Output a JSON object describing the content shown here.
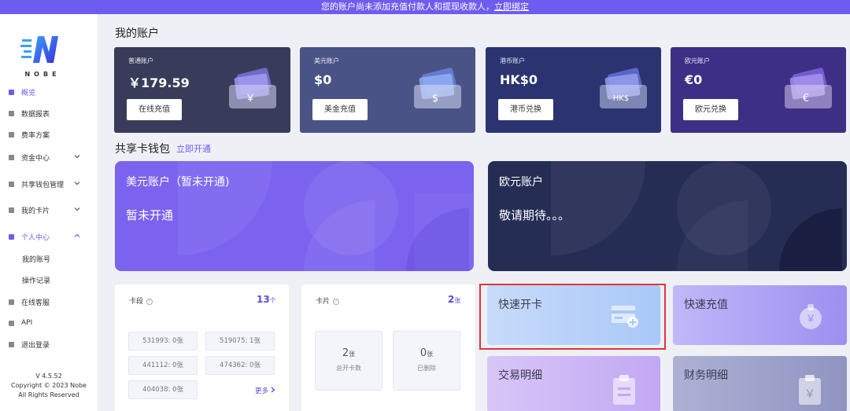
{
  "banner": {
    "text": "您的账户尚未添加充值付款人和提现收款人，",
    "link": "立即绑定"
  },
  "colors": {
    "accent": "#6e5cf0",
    "banner": "#6e5cf0",
    "highlight": "#e03535"
  },
  "logo": {
    "text": "NOBE"
  },
  "nav": {
    "items": [
      {
        "label": "概览",
        "icon": "home-icon",
        "active": true
      },
      {
        "label": "数据报表",
        "icon": "chart-icon"
      },
      {
        "label": "费率方案",
        "icon": "rate-icon"
      },
      {
        "label": "资金中心",
        "icon": "fund-icon",
        "chevron": "down"
      },
      {
        "label": "共享钱包管理",
        "icon": "wallet-icon",
        "chevron": "down"
      },
      {
        "label": "我的卡片",
        "icon": "card-icon",
        "chevron": "down"
      },
      {
        "label": "个人中心",
        "icon": "user-icon",
        "chevron": "up"
      },
      {
        "label": "在线客服",
        "icon": "service-icon"
      },
      {
        "label": "API",
        "icon": "api-icon"
      },
      {
        "label": "退出登录",
        "icon": "logout-icon"
      }
    ],
    "subitems": [
      "我的账号",
      "操作记录"
    ]
  },
  "footer": {
    "version": "V 4.5.52",
    "copyright": "Copyright © 2023 Nobe",
    "rights": "All Rights Reserved"
  },
  "my_account": {
    "title": "我的账户",
    "cards": [
      {
        "name": "普通账户",
        "amount": "￥179.59",
        "button": "在线充值",
        "symbol": "￥",
        "color": "#383c5a"
      },
      {
        "name": "美元账户",
        "amount": "$0",
        "button": "美金充值",
        "symbol": "$",
        "color": "#4a5385"
      },
      {
        "name": "港币账户",
        "amount": "HK$0",
        "button": "港币兑换",
        "symbol": "HK$",
        "color": "#2b3371"
      },
      {
        "name": "欧元账户",
        "amount": "€0",
        "button": "欧元兑换",
        "symbol": "€",
        "color": "#3d2f86"
      }
    ]
  },
  "shared_wallet": {
    "title": "共享卡钱包",
    "link": "立即开通",
    "cards": [
      {
        "title": "美元账户（暂未开通)",
        "subtitle": "暂未开通",
        "color": "#7b63ef"
      },
      {
        "title": "欧元账户",
        "subtitle": "敬请期待。。。",
        "color": "#262d55"
      }
    ]
  },
  "card_segment": {
    "label": "卡段",
    "help": "?",
    "count": "13",
    "unit": "个",
    "chips": [
      "531993: 0张",
      "519075: 1张",
      "441112: 0张",
      "474362: 0张",
      "404038: 0张"
    ],
    "more": "更多"
  },
  "cards_panel": {
    "label": "卡片",
    "help": "?",
    "count": "2",
    "unit": "张",
    "stats": [
      {
        "value": "2",
        "unit": "张",
        "label": "总开卡数"
      },
      {
        "value": "0",
        "unit": "张",
        "label": "已删除"
      }
    ]
  },
  "actions": [
    {
      "label": "快速开卡",
      "icon": "card-add-icon"
    },
    {
      "label": "快速充值",
      "icon": "recharge-icon"
    },
    {
      "label": "交易明细",
      "icon": "clipboard-icon"
    },
    {
      "label": "财务明细",
      "icon": "finance-icon"
    }
  ]
}
